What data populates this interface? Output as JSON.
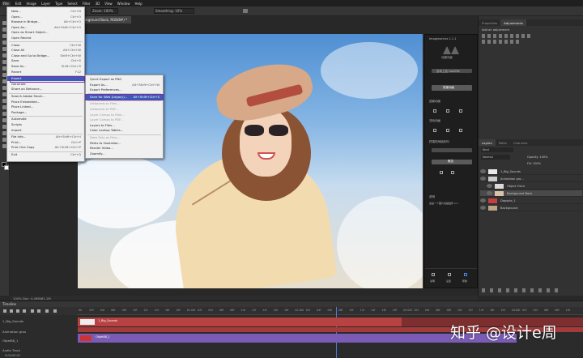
{
  "menubar": {
    "items": [
      "File",
      "Edit",
      "Image",
      "Layer",
      "Type",
      "Select",
      "Filter",
      "3D",
      "View",
      "Window",
      "Help"
    ]
  },
  "options_bar": {
    "zoom_label": "Zoom: 100%",
    "smoothing_label": "Smoothing: 10%"
  },
  "document_tab": "Background Back, RGB/8#) *",
  "file_menu": {
    "items": [
      {
        "label": "New...",
        "shortcut": "Ctrl+N"
      },
      {
        "label": "Open...",
        "shortcut": "Ctrl+O"
      },
      {
        "label": "Browse in Bridge...",
        "shortcut": "Alt+Ctrl+O"
      },
      {
        "label": "Open As...",
        "shortcut": "Alt+Shift+Ctrl+O"
      },
      {
        "label": "Open as Smart Object...",
        "shortcut": ""
      },
      {
        "label": "Open Recent",
        "shortcut": ""
      },
      {
        "label": "Close",
        "shortcut": "Ctrl+W"
      },
      {
        "label": "Close All",
        "shortcut": "Alt+Ctrl+W"
      },
      {
        "label": "Close and Go to Bridge...",
        "shortcut": "Shift+Ctrl+W"
      },
      {
        "label": "Save",
        "shortcut": "Ctrl+S"
      },
      {
        "label": "Save As...",
        "shortcut": "Shift+Ctrl+S"
      },
      {
        "label": "Revert",
        "shortcut": "F12"
      },
      {
        "label": "Export",
        "shortcut": ""
      },
      {
        "label": "Generate",
        "shortcut": ""
      },
      {
        "label": "Share on Behance...",
        "shortcut": ""
      },
      {
        "label": "Search Adobe Stock...",
        "shortcut": ""
      },
      {
        "label": "Place Embedded...",
        "shortcut": ""
      },
      {
        "label": "Place Linked...",
        "shortcut": ""
      },
      {
        "label": "Package...",
        "shortcut": ""
      },
      {
        "label": "Automate",
        "shortcut": ""
      },
      {
        "label": "Scripts",
        "shortcut": ""
      },
      {
        "label": "Import",
        "shortcut": ""
      },
      {
        "label": "File Info...",
        "shortcut": "Alt+Shift+Ctrl+I"
      },
      {
        "label": "Print...",
        "shortcut": "Ctrl+P"
      },
      {
        "label": "Print One Copy",
        "shortcut": "Alt+Shift+Ctrl+P"
      },
      {
        "label": "Exit",
        "shortcut": "Ctrl+Q"
      }
    ]
  },
  "export_menu": {
    "items": [
      {
        "label": "Quick Export as PNG",
        "shortcut": ""
      },
      {
        "label": "Export As...",
        "shortcut": "Alt+Shift+Ctrl+W"
      },
      {
        "label": "Export Preferences...",
        "shortcut": ""
      },
      {
        "label": "Save for Web (Legacy)...",
        "shortcut": "Alt+Shift+Ctrl+S"
      },
      {
        "label": "Artboards to Files...",
        "shortcut": ""
      },
      {
        "label": "Artboards to PDF...",
        "shortcut": ""
      },
      {
        "label": "Layer Comps to Files...",
        "shortcut": ""
      },
      {
        "label": "Layer Comps to PDF...",
        "shortcut": ""
      },
      {
        "label": "Layers to Files...",
        "shortcut": ""
      },
      {
        "label": "Color Lookup Tables...",
        "shortcut": ""
      },
      {
        "label": "Data Sets as Files...",
        "shortcut": ""
      },
      {
        "label": "Paths to Illustrator...",
        "shortcut": ""
      },
      {
        "label": "Render Video...",
        "shortcut": ""
      },
      {
        "label": "Zoomify...",
        "shortcut": ""
      }
    ]
  },
  "plugin": {
    "title": "Imagenomics 1.1.1",
    "brand": "动感光影",
    "sub": "自动上色 Loadfile",
    "primary_button": "快速动画",
    "section1": "适景动画",
    "section2": "流动动画",
    "section3": "终端时间帧序列",
    "section4": "概览",
    "help_title": "说明",
    "help_text": "这是一个图片动画插件 1.1",
    "footer_tabs": [
      "说明",
      "设置",
      "帮助"
    ]
  },
  "right_panels": {
    "top_tabs": [
      "Properties",
      "Adjustments"
    ],
    "adjust_hint": "Add an adjustment",
    "layers_tabs": [
      "Layers",
      "Paths",
      "Channels"
    ],
    "kind_label": "Kind",
    "blend_mode": "Normal",
    "opacity_label": "Opacity: 100%",
    "fill_label": "Fill: 100%",
    "layers": [
      {
        "name": "1_Big_Sounds",
        "thumb": "#e8e8e8",
        "selected": false
      },
      {
        "name": "Animation gro...",
        "thumb": "#cccccc",
        "selected": false
      },
      {
        "name": "Object Front",
        "thumb": "#d9d9d9",
        "selected": false
      },
      {
        "name": "Background Back",
        "thumb": "#d8c3a8",
        "selected": true
      },
      {
        "name": "Dopsole_1",
        "thumb": "#c34040",
        "selected": false
      },
      {
        "name": "Background",
        "thumb": "#bfa488",
        "selected": false
      }
    ]
  },
  "status_bar": "100%   Doc: 4.49M/61.1M",
  "timeline": {
    "title": "Timeline",
    "ticks": [
      "00",
      "02f",
      "04f",
      "06f",
      "08f",
      "10f",
      "12f",
      "14f",
      "16f",
      "18f",
      "01:00f",
      "02f",
      "04f",
      "06f",
      "08f",
      "10f",
      "12f",
      "14f",
      "16f",
      "18f",
      "02:00f",
      "02f",
      "04f",
      "06f",
      "08f",
      "10f",
      "12f",
      "14f",
      "16f",
      "18f",
      "03:00f",
      "02f",
      "04f",
      "06f",
      "08f",
      "10f",
      "12f",
      "14f",
      "16f",
      "18f",
      "04:00f",
      "02f",
      "04f",
      "06f",
      "08f",
      "10f"
    ],
    "tracks": [
      {
        "label": "1_Big_Sounds",
        "clip": "1_Big_Sounds",
        "color": "#b84242"
      },
      {
        "label": "Animation grou",
        "clip": "",
        "color": "#a53a3a"
      },
      {
        "label": "Objet88_1",
        "clip": "Objet88_1",
        "color": "#7a5bb5"
      },
      {
        "label": "Audio Track",
        "clip": "",
        "color": "#2b2b2b"
      }
    ],
    "timecode": "0:00:00:01"
  },
  "watermark": "知乎 @设计e周",
  "colors": {
    "accent_highlight": "#3a5cb8",
    "annotation_outline": "#7b2da8"
  }
}
